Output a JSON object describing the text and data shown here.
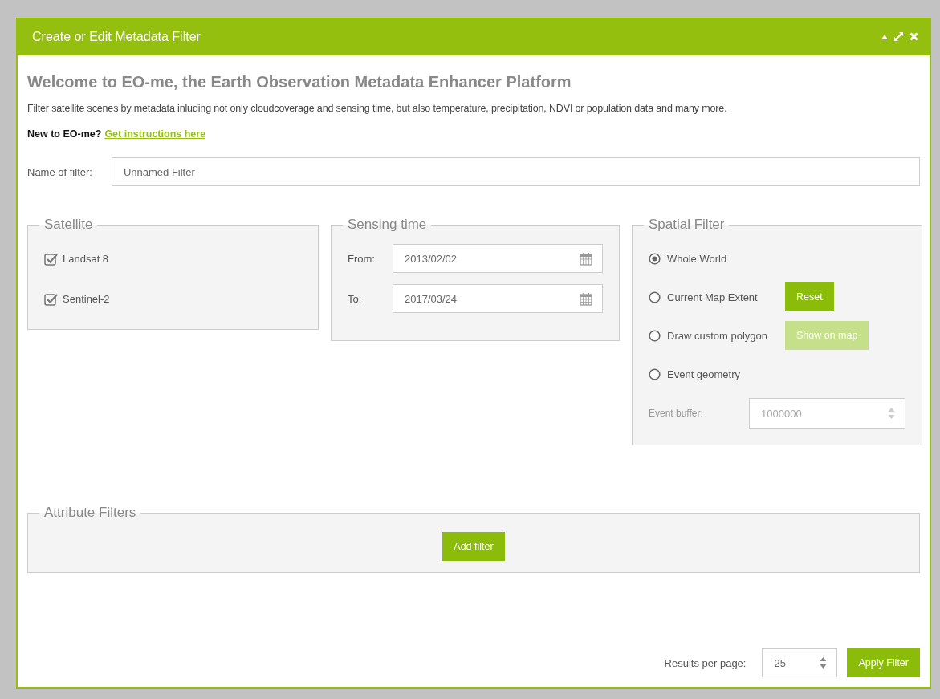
{
  "dialog": {
    "title": "Create or Edit Metadata Filter"
  },
  "heading": "Welcome to EO-me, the Earth Observation Metadata Enhancer Platform",
  "intro": "Filter satellite scenes by metadata inluding not only cloudcoverage and sensing time, but also temperature, precipitation, NDVI or population data and many more.",
  "help": {
    "text": "New to EO-me?",
    "link": "Get instructions here"
  },
  "name_field": {
    "label": "Name of filter:",
    "value": "Unnamed Filter"
  },
  "satellite": {
    "legend": "Satellite",
    "options": [
      {
        "label": "Landsat 8",
        "checked": true
      },
      {
        "label": "Sentinel-2",
        "checked": true
      }
    ]
  },
  "sensing_time": {
    "legend": "Sensing time",
    "fields": [
      {
        "label": "From:",
        "value": "2013/02/02"
      },
      {
        "label": "To:",
        "value": "2017/03/24"
      }
    ]
  },
  "spatial_filter": {
    "legend": "Spatial Filter",
    "options": [
      {
        "label": "Whole World",
        "selected": true
      },
      {
        "label": "Current Map Extent",
        "selected": false,
        "button": {
          "label": "Reset",
          "disabled": false
        }
      },
      {
        "label": "Draw custom polygon",
        "selected": false,
        "button": {
          "label": "Show on map",
          "disabled": true
        }
      },
      {
        "label": "Event geometry",
        "selected": false
      }
    ],
    "buffer": {
      "label": "Event buffer:",
      "value": "1000000",
      "disabled": true
    }
  },
  "attribute_filters": {
    "legend": "Attribute Filters",
    "button": "Add filter"
  },
  "footer": {
    "results_label": "Results per page:",
    "results_value": "25",
    "apply": "Apply Filter"
  }
}
